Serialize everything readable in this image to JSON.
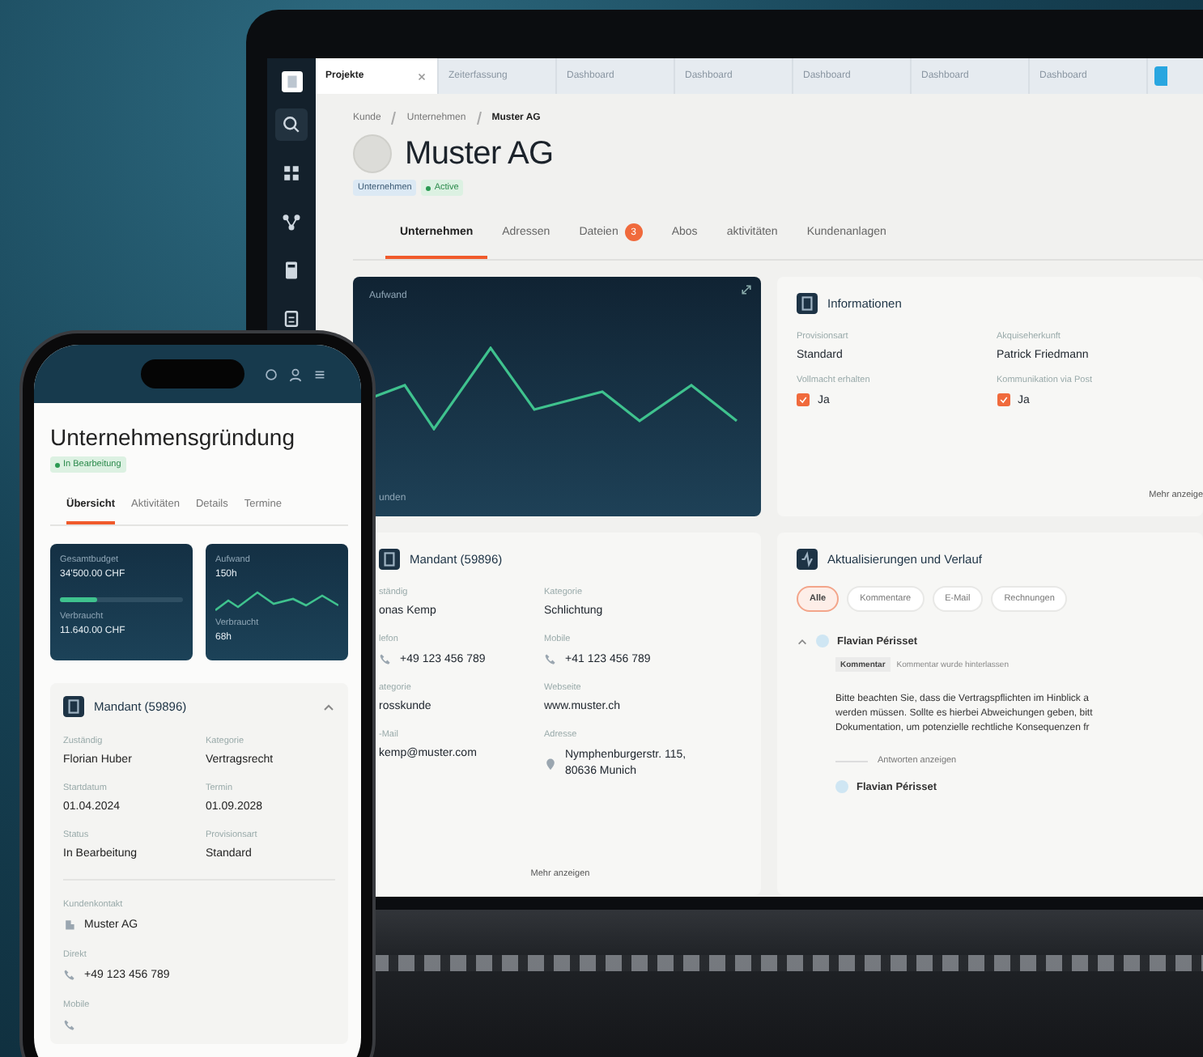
{
  "laptop": {
    "app_tabs": [
      {
        "label": "Projekte",
        "selected": true,
        "closable": true
      },
      {
        "label": "Zeiterfassung",
        "selected": false,
        "closable": false
      },
      {
        "label": "Dashboard",
        "selected": false,
        "closable": false
      },
      {
        "label": "Dashboard",
        "selected": false,
        "closable": false
      },
      {
        "label": "Dashboard",
        "selected": false,
        "closable": false
      },
      {
        "label": "Dashboard",
        "selected": false,
        "closable": false
      },
      {
        "label": "Dashboard",
        "selected": false,
        "closable": false
      }
    ],
    "breadcrumb": [
      "Kunde",
      "Unternehmen",
      "Muster AG"
    ],
    "title": "Muster AG",
    "tags": [
      {
        "label": "Unternehmen",
        "kind": "plain"
      },
      {
        "label": "Active",
        "kind": "status"
      }
    ],
    "tabs": [
      {
        "label": "Unternehmen",
        "selected": true
      },
      {
        "label": "Adressen",
        "selected": false
      },
      {
        "label": "Dateien",
        "selected": false,
        "badge": "3"
      },
      {
        "label": "Abos",
        "selected": false
      },
      {
        "label": "aktivitäten",
        "selected": false
      },
      {
        "label": "Kundenanlagen",
        "selected": false
      }
    ],
    "effort_card": {
      "title": "Aufwand",
      "axis_label": "unden"
    },
    "info_card": {
      "title": "Informationen",
      "fields": [
        {
          "label": "Provisionsart",
          "value": "Standard",
          "kind": "text"
        },
        {
          "label": "Akquiseherkunft",
          "value": "Patrick Friedmann",
          "kind": "text"
        },
        {
          "label": "Vollmacht erhalten",
          "value": "Ja",
          "kind": "check",
          "checked": true
        },
        {
          "label": "Kommunikation via Post",
          "value": "Ja",
          "kind": "check",
          "checked": true
        }
      ],
      "more": "Mehr anzeige"
    },
    "mandant_card": {
      "title": "Mandant (59896)",
      "fields": [
        {
          "label": "ständig",
          "value": "onas Kemp",
          "kind": "text"
        },
        {
          "label": "Kategorie",
          "value": "Schlichtung",
          "kind": "text"
        },
        {
          "label": "lefon",
          "value": "+49 123 456 789",
          "kind": "phone"
        },
        {
          "label": "Mobile",
          "value": "+41 123 456 789",
          "kind": "phone"
        },
        {
          "label": "ategorie",
          "value": "rosskunde",
          "kind": "text"
        },
        {
          "label": "Webseite",
          "value": "www.muster.ch",
          "kind": "text"
        },
        {
          "label": "-Mail",
          "value": "kemp@muster.com",
          "kind": "text"
        },
        {
          "label": "Adresse",
          "value": "Nymphenburgerstr. 115, 80636 Munich",
          "kind": "address"
        }
      ],
      "more": "Mehr anzeigen"
    },
    "updates_card": {
      "title": "Aktualisierungen und Verlauf",
      "filters": [
        {
          "label": "Alle",
          "selected": true
        },
        {
          "label": "Kommentare",
          "selected": false
        },
        {
          "label": "E-Mail",
          "selected": false
        },
        {
          "label": "Rechnungen",
          "selected": false
        }
      ],
      "entries": [
        {
          "author": "Flavian Périsset",
          "expanded": true,
          "tag": "Kommentar",
          "note": "Kommentar wurde hinterlassen",
          "lines": [
            "Bitte beachten Sie, dass die Vertragspflichten im Hinblick a",
            "werden müssen. Sollte es hierbei Abweichungen geben, bitt",
            "Dokumentation, um potenzielle rechtliche Konsequenzen fr"
          ],
          "replies": "Antworten anzeigen"
        },
        {
          "author": "Flavian Périsset"
        }
      ]
    }
  },
  "phone": {
    "title": "Unternehmensgründung",
    "status": {
      "label": "In Bearbeitung",
      "kind": "status"
    },
    "tabs": [
      {
        "label": "Übersicht",
        "selected": true
      },
      {
        "label": "Aktivitäten",
        "selected": false
      },
      {
        "label": "Details",
        "selected": false
      },
      {
        "label": "Termine",
        "selected": false
      }
    ],
    "budget_card": {
      "label": "Gesamtbudget",
      "value": "34'500.00 CHF",
      "level": 0.3,
      "used_label": "Verbraucht",
      "used_value": "11.640.00 CHF"
    },
    "effort_card": {
      "label": "Aufwand",
      "value": "150h",
      "used_label": "Verbraucht",
      "used_value": "68h"
    },
    "mandant": {
      "title": "Mandant (59896)",
      "expanded": true,
      "fields": [
        {
          "label": "Zuständig",
          "value": "Florian Huber"
        },
        {
          "label": "Kategorie",
          "value": "Vertragsrecht"
        },
        {
          "label": "Startdatum",
          "value": "01.04.2024"
        },
        {
          "label": "Termin",
          "value": "01.09.2028"
        },
        {
          "label": "Status",
          "value": "In Bearbeitung"
        },
        {
          "label": "Provisionsart",
          "value": "Standard"
        }
      ],
      "contacts": [
        {
          "label": "Kundenkontakt",
          "value": "Muster AG",
          "kind": "company"
        },
        {
          "label": "Direkt",
          "value": "+49 123 456 789",
          "kind": "phone"
        },
        {
          "label": "Mobile",
          "kind": "phone"
        }
      ]
    }
  }
}
